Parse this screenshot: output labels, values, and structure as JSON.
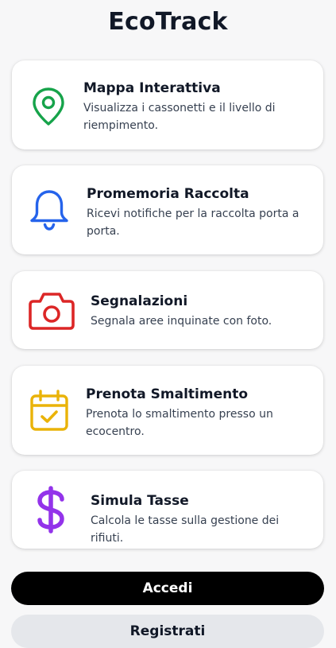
{
  "app": {
    "title": "EcoTrack"
  },
  "features": [
    {
      "title": "Mappa Interattiva",
      "description": "Visualizza i cassonetti e il livello di riempimento.",
      "icon": "map-pin-icon",
      "color": "#16a34a"
    },
    {
      "title": "Promemoria Raccolta",
      "description": "Ricevi notifiche per la raccolta porta a porta.",
      "icon": "bell-icon",
      "color": "#2563eb"
    },
    {
      "title": "Segnalazioni",
      "description": "Segnala aree inquinate con foto.",
      "icon": "camera-icon",
      "color": "#dc2626"
    },
    {
      "title": "Prenota Smaltimento",
      "description": "Prenota lo smaltimento presso un ecocentro.",
      "icon": "calendar-check-icon",
      "color": "#eab308"
    },
    {
      "title": "Simula Tasse",
      "description": "Calcola le tasse sulla gestione dei rifiuti.",
      "icon": "dollar-icon",
      "color": "#9333ea"
    }
  ],
  "actions": {
    "login_label": "Accedi",
    "register_label": "Registrati"
  }
}
